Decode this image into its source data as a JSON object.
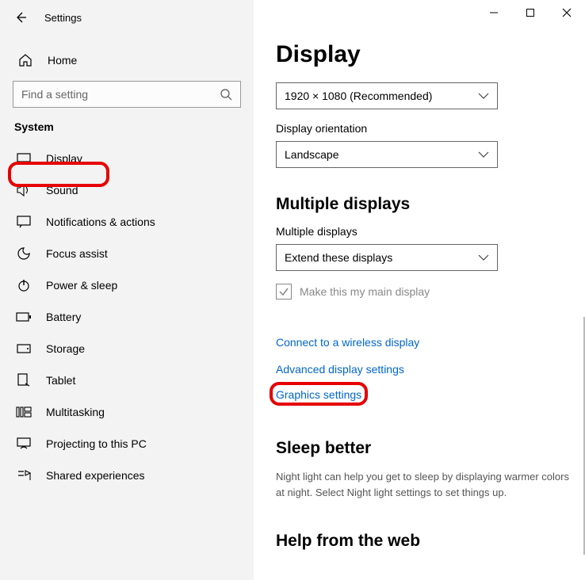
{
  "window": {
    "title": "Settings"
  },
  "sidebar": {
    "home_label": "Home",
    "search_placeholder": "Find a setting",
    "section_label": "System",
    "items": [
      {
        "label": "Display"
      },
      {
        "label": "Sound"
      },
      {
        "label": "Notifications & actions"
      },
      {
        "label": "Focus assist"
      },
      {
        "label": "Power & sleep"
      },
      {
        "label": "Battery"
      },
      {
        "label": "Storage"
      },
      {
        "label": "Tablet"
      },
      {
        "label": "Multitasking"
      },
      {
        "label": "Projecting to this PC"
      },
      {
        "label": "Shared experiences"
      }
    ]
  },
  "main": {
    "title": "Display",
    "resolution_value": "1920 × 1080 (Recommended)",
    "orientation_label": "Display orientation",
    "orientation_value": "Landscape",
    "multi_heading": "Multiple displays",
    "multi_label": "Multiple displays",
    "multi_value": "Extend these displays",
    "make_main_label": "Make this my main display",
    "link_wireless": "Connect to a wireless display",
    "link_advanced": "Advanced display settings",
    "link_graphics": "Graphics settings",
    "sleep_heading": "Sleep better",
    "sleep_desc": "Night light can help you get to sleep by displaying warmer colors at night. Select Night light settings to set things up.",
    "help_heading": "Help from the web"
  }
}
